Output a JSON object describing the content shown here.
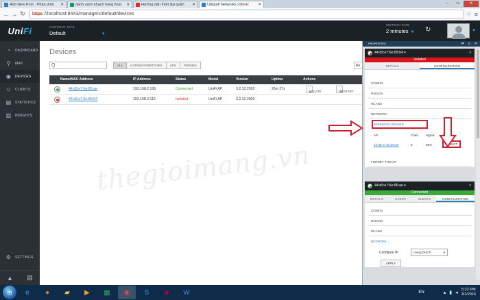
{
  "browser": {
    "tabs": [
      {
        "title": "Add New Post · Phân phối",
        "icon": "wordpress-icon",
        "color": "#2a7fc1",
        "active": false
      },
      {
        "title": "danh sach khach hang final",
        "icon": "sheets-icon",
        "color": "#0f9d58",
        "active": false
      },
      {
        "title": "Hướng dẫn thiết lập quản",
        "icon": "doc-icon",
        "color": "#d93025",
        "active": false
      },
      {
        "title": "Ubiquiti Networks | Devic",
        "icon": "ubiquiti-icon",
        "color": "#2a7fc1",
        "active": true
      }
    ],
    "url_scheme": "https",
    "url_rest": "://localhost:8443/manage/s/default/devices"
  },
  "header": {
    "logo_a": "Uni",
    "logo_b": "Fi",
    "site_label": "CURRENT SITE",
    "site_value": "Default",
    "refresh_label": "REFRESH RATE",
    "refresh_value": "2 minutes"
  },
  "sidebar": {
    "items": [
      {
        "label": "DASHBOARD",
        "icon": "dashboard-icon",
        "glyph": "◔"
      },
      {
        "label": "MAP",
        "icon": "map-pin-icon",
        "glyph": "⚲"
      },
      {
        "label": "DEVICES",
        "icon": "devices-icon",
        "glyph": "◉",
        "active": true
      },
      {
        "label": "CLIENTS",
        "icon": "clients-icon",
        "glyph": "☺"
      },
      {
        "label": "STATISTICS",
        "icon": "statistics-icon",
        "glyph": "▤"
      },
      {
        "label": "INSIGHTS",
        "icon": "insights-icon",
        "glyph": "▥"
      }
    ],
    "settings": "SETTINGS"
  },
  "main": {
    "title": "Devices",
    "search_value": "Q",
    "filters": [
      "ALL",
      "GATEWAY/SWITCHES",
      "APS",
      "PHONES"
    ],
    "active_filter": "ALL",
    "right_btn": "Re",
    "columns": [
      "Name/MAC Address",
      "IP Address",
      "Status",
      "Model",
      "Version",
      "Uptime",
      "Actions"
    ],
    "rows": [
      {
        "name": "44:d9:e7:6e:86:ae",
        "ip": "192.168.2.135",
        "status": "Connected",
        "model": "UniFi AP",
        "version": "3.2.12.2920",
        "uptime": "25m 27s",
        "locate": "LOCATE",
        "restart": "RESTART",
        "dot": "#3aa93a"
      },
      {
        "name": "44:d9:e7:6e:89:04",
        "ip": "192.168.2.115",
        "status": "Isolated",
        "model": "UniFi AP",
        "version": "3.2.12.2920",
        "uptime": "",
        "dot": "#d33"
      }
    ]
  },
  "watermark": "thegioimang.vn",
  "panel": {
    "title": "PROPERTIES",
    "dev1": {
      "name": "44:d9:e7:6e:89:04",
      "status": "Isolated",
      "tabs": [
        "DETAILS",
        "CONFIGURATION"
      ],
      "sections": [
        "CONFIG",
        "RADIOS",
        "WLANS",
        "NETWORK",
        "WIRELESS UPLINKS"
      ],
      "uplink_cols": [
        "AP",
        "Chan.",
        "Signal",
        "Action"
      ],
      "uplink_row": {
        "ap": "44:d9:e7:6e:86:ae",
        "chan": "6",
        "signal": "99%",
        "action": "SELECT"
      },
      "forget": "FORGET THIS AP"
    },
    "dev2": {
      "name": "44:d9:e7:6e:86:ae",
      "status": "Connected",
      "tabs": [
        "DETAILS",
        "USERS",
        "GUESTS",
        "CONFIGURATION"
      ],
      "sections": [
        "CONFIG",
        "RADIOS",
        "WLANS",
        "NETWORK"
      ],
      "configure_ip_label": "Configure IP",
      "configure_ip_value": "Using DHCP",
      "apply": "APPLY"
    }
  },
  "taskbar": {
    "lang": "EN",
    "time": "5:22 PM",
    "date": "3/1/2016"
  }
}
